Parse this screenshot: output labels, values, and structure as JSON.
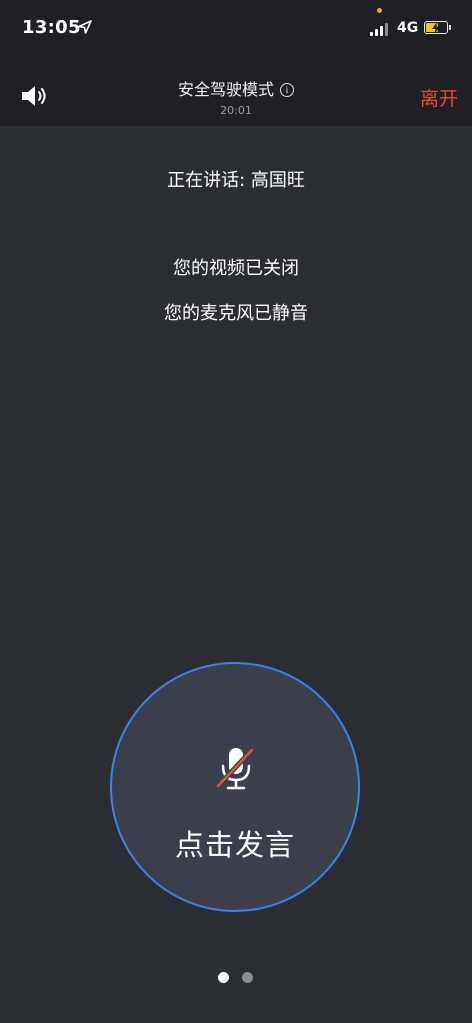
{
  "status_bar": {
    "time": "13:05",
    "network": "4G",
    "battery_level": 0.55,
    "colors": {
      "battery": "#f5c518",
      "indicator_dot": "#f0a030"
    }
  },
  "header": {
    "speaker_icon": "speaker-icon",
    "title": "安全驾驶模式",
    "info_icon": "info-icon",
    "timer": "20:01",
    "leave_label": "离开",
    "colors": {
      "leave": "#e8483f"
    }
  },
  "main": {
    "speaking_text": "正在讲话: 高国旺",
    "video_status": "您的视频已关闭",
    "mic_status": "您的麦克风已静音"
  },
  "talk_button": {
    "icon": "muted-microphone-icon",
    "label": "点击发言",
    "colors": {
      "border": "#3b82ea",
      "fill": "#3b3f4b",
      "mute_slash": "#e0513f"
    }
  },
  "pagination": {
    "total": 2,
    "active_index": 0
  }
}
